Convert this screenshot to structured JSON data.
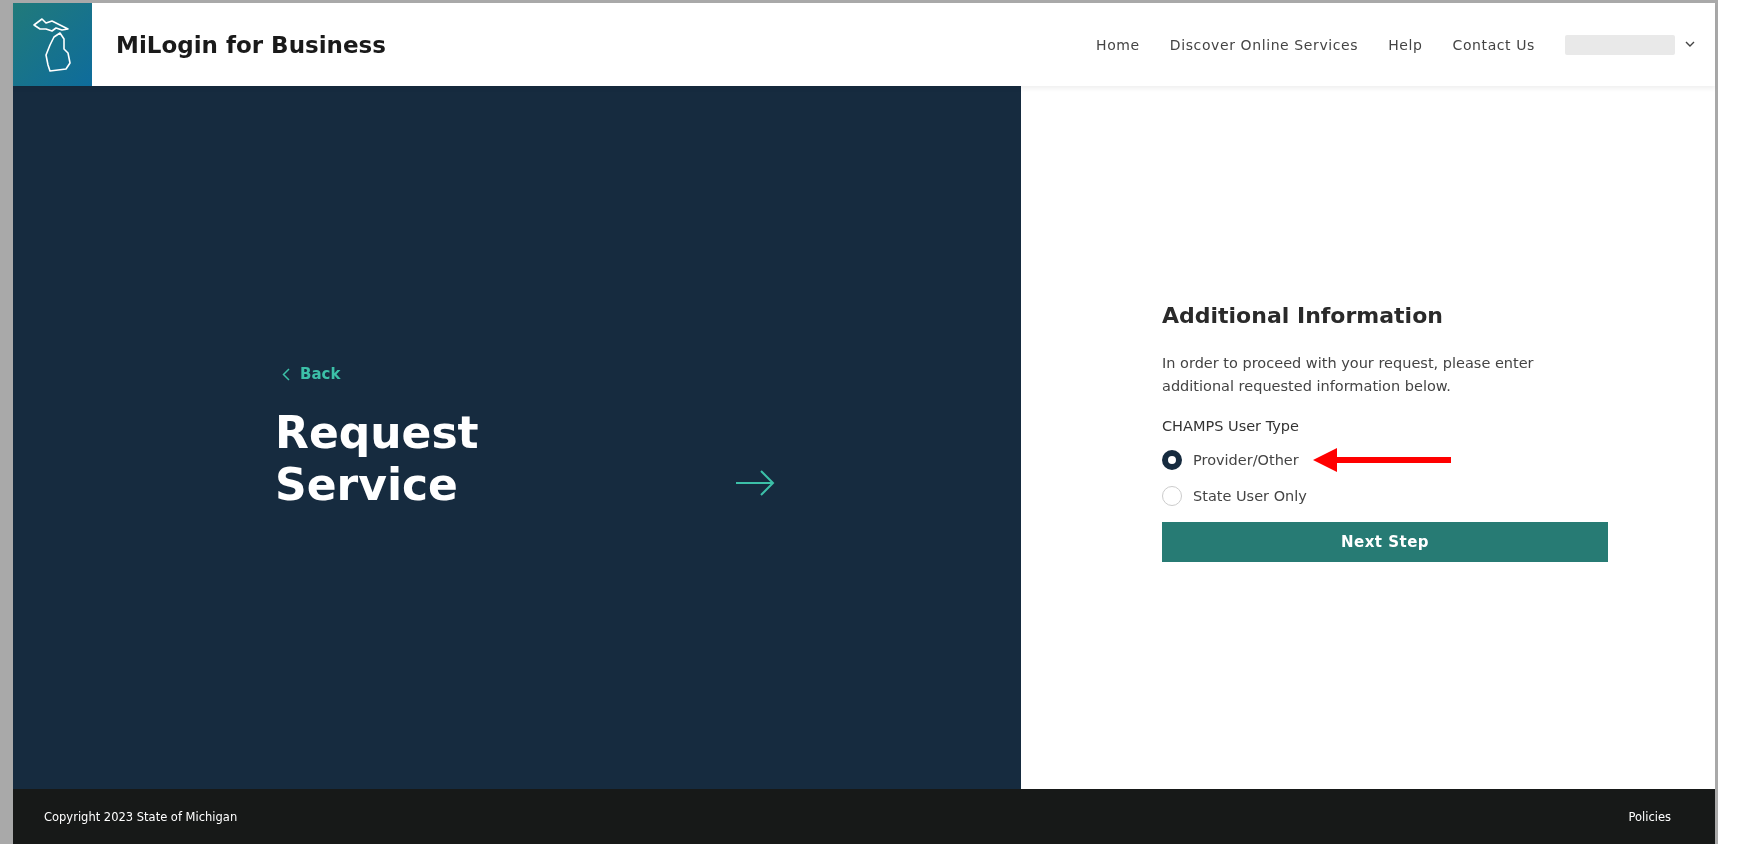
{
  "header": {
    "title": "MiLogin for Business",
    "nav": [
      {
        "label": "Home"
      },
      {
        "label": "Discover Online Services"
      },
      {
        "label": "Help"
      },
      {
        "label": "Contact Us"
      }
    ]
  },
  "hero": {
    "back": "Back",
    "title": "Request Service"
  },
  "form": {
    "heading": "Additional Information",
    "intro": "In order to proceed with your request, please enter additional requested information below.",
    "field_label": "CHAMPS User Type",
    "options": [
      {
        "label": "Provider/Other",
        "selected": true,
        "annotated": true
      },
      {
        "label": "State User Only",
        "selected": false,
        "annotated": false
      }
    ],
    "submit": "Next Step"
  },
  "footer": {
    "copyright": "Copyright 2023 State of Michigan",
    "link": "Policies"
  }
}
